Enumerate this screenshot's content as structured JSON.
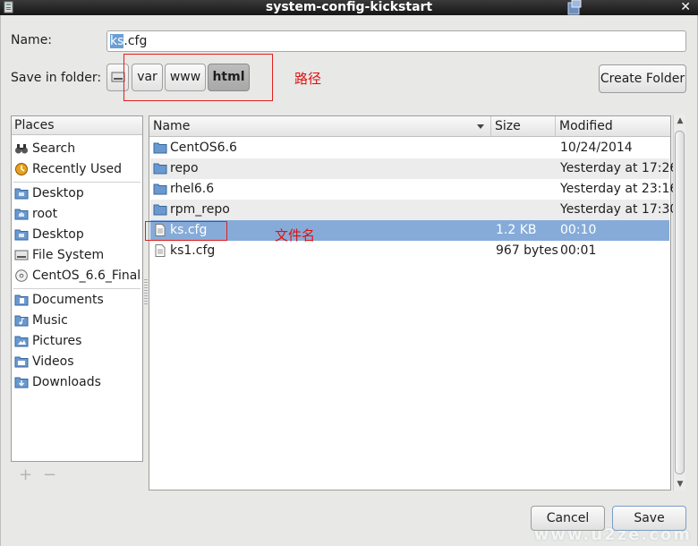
{
  "window": {
    "title": "system-config-kickstart",
    "close_glyph": "✕"
  },
  "name_field": {
    "label": "Name:",
    "selected_part": "ks",
    "rest": ".cfg"
  },
  "save_in": {
    "label": "Save in folder:",
    "crumbs": [
      "var",
      "www",
      "html"
    ],
    "active_crumb": "html",
    "create_folder": "Create Folder"
  },
  "annotations": {
    "path": "路径",
    "filename": "文件名",
    "color": "#e02020"
  },
  "places": {
    "header": "Places",
    "groups": [
      [
        {
          "label": "Search",
          "icon": "binoculars-icon"
        },
        {
          "label": "Recently Used",
          "icon": "clock-icon"
        }
      ],
      [
        {
          "label": "Desktop",
          "icon": "folder-desktop-icon"
        },
        {
          "label": "root",
          "icon": "home-folder-icon"
        },
        {
          "label": "Desktop",
          "icon": "folder-desktop-icon"
        },
        {
          "label": "File System",
          "icon": "drive-icon"
        },
        {
          "label": "CentOS_6.6_Final",
          "icon": "disc-icon"
        }
      ],
      [
        {
          "label": "Documents",
          "icon": "folder-documents-icon"
        },
        {
          "label": "Music",
          "icon": "folder-music-icon"
        },
        {
          "label": "Pictures",
          "icon": "folder-pictures-icon"
        },
        {
          "label": "Videos",
          "icon": "folder-videos-icon"
        },
        {
          "label": "Downloads",
          "icon": "folder-downloads-icon"
        }
      ]
    ],
    "add_glyph": "+",
    "remove_glyph": "−"
  },
  "files": {
    "columns": {
      "name": "Name",
      "size": "Size",
      "modified": "Modified"
    },
    "rows": [
      {
        "name": "CentOS6.6",
        "type": "folder",
        "size": "",
        "modified": "10/24/2014"
      },
      {
        "name": "repo",
        "type": "folder",
        "size": "",
        "modified": "Yesterday at 17:26"
      },
      {
        "name": "rhel6.6",
        "type": "folder",
        "size": "",
        "modified": "Yesterday at 23:16"
      },
      {
        "name": "rpm_repo",
        "type": "folder",
        "size": "",
        "modified": "Yesterday at 17:30"
      },
      {
        "name": "ks.cfg",
        "type": "file",
        "size": "1.2 KB",
        "modified": "00:10",
        "selected": true
      },
      {
        "name": "ks1.cfg",
        "type": "file",
        "size": "967 bytes",
        "modified": "00:01"
      }
    ]
  },
  "buttons": {
    "cancel": "Cancel",
    "save": "Save"
  },
  "watermark": "www.u2ze.com",
  "colors": {
    "selection": "#86abd9",
    "titlebar": "#222222"
  }
}
